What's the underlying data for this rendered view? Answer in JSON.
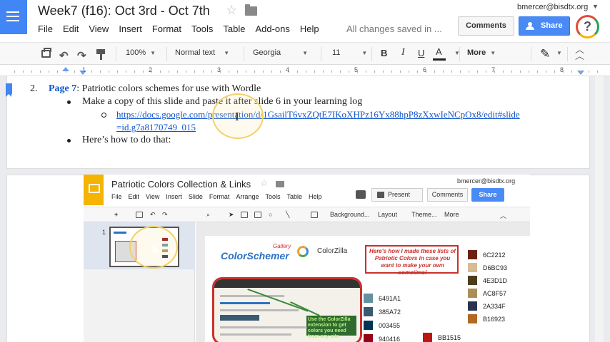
{
  "app": {
    "doc_title": "Week7 (f16): Oct 3rd - Oct 7th",
    "menu": [
      "File",
      "Edit",
      "View",
      "Insert",
      "Format",
      "Tools",
      "Table",
      "Add-ons",
      "Help"
    ],
    "save_status": "All changes saved in ...",
    "user_email": "bmercer@bisdtx.org",
    "comments_label": "Comments",
    "share_label": "Share",
    "help_glyph": "?"
  },
  "toolbar": {
    "zoom": "100%",
    "style": "Normal text",
    "font": "Georgia",
    "size": "11",
    "bold": "B",
    "italic": "I",
    "underline": "U",
    "text_color": "A",
    "more": "More"
  },
  "ruler": {
    "numbers": [
      "1",
      "2",
      "3",
      "4",
      "5",
      "6",
      "7",
      "8"
    ]
  },
  "document": {
    "item_number": "2.",
    "item_link": "Page 7",
    "item_text": ": Patriotic colors schemes for use with Wordle",
    "bullet1": "Make a copy of this slide and paste it after slide 6 in your learning log",
    "url_line1": "https://docs.google.com/presentation/d/1GsailT6vxZQtE7IKoXHPz16Yx88hpP8zXxwIeNCpOx8/edit#slide",
    "url_line2": "=id.g7a8170749_015",
    "bullet2": "Here’s how to do that:"
  },
  "embedded": {
    "title": "Patriotic Colors Collection & Links",
    "user_email": "bmercer@bisdtx.org",
    "menu": [
      "File",
      "Edit",
      "View",
      "Insert",
      "Slide",
      "Format",
      "Arrange",
      "Tools",
      "Table",
      "Help"
    ],
    "present_label": "Present",
    "comments_label": "Comments",
    "share_label": "Share",
    "toolbar": {
      "background": "Background...",
      "layout": "Layout",
      "theme": "Theme...",
      "more": "More"
    },
    "slide_number": "1",
    "slide": {
      "logo": "ColorSchemer",
      "logo_sub": "Gallery",
      "colorzilla": "ColorZilla",
      "note": "Here's how I made these lists of Patriotic Colors in case you want to make your own sometime!",
      "callout": "Use the ColorZilla extension to get colors you need from any site",
      "swatches_left": [
        {
          "hex": "6491A1",
          "color": "#6491a1"
        },
        {
          "hex": "385A72",
          "color": "#385a72"
        },
        {
          "hex": "003455",
          "color": "#003455"
        },
        {
          "hex": "940416",
          "color": "#940416"
        }
      ],
      "swatch_mid": {
        "hex": "BB1515",
        "color": "#bb1515"
      },
      "swatches_right": [
        {
          "hex": "6C2212",
          "color": "#6c2212"
        },
        {
          "hex": "D6BC93",
          "color": "#d6bc93"
        },
        {
          "hex": "4E3D1D",
          "color": "#4e3d1d"
        },
        {
          "hex": "AC8F57",
          "color": "#ac8f57"
        },
        {
          "hex": "2A334F",
          "color": "#2a334f"
        },
        {
          "hex": "B16923",
          "color": "#b16923"
        }
      ]
    }
  },
  "icons": [
    "docs-icon",
    "star-icon",
    "folder-icon",
    "share-person-icon",
    "print-icon",
    "undo-icon",
    "redo-icon",
    "paint-format-icon",
    "pen-icon",
    "collapse-icon",
    "slides-icon",
    "bookmark-icon",
    "cursor-ibeam-icon",
    "pointer-arrow-icon"
  ]
}
